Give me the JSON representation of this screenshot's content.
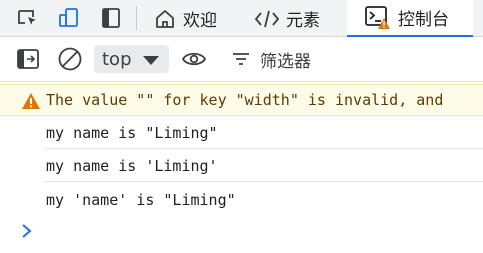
{
  "tabs": [
    {
      "label": "欢迎"
    },
    {
      "label": "元素"
    },
    {
      "label": "控制台"
    }
  ],
  "toolbar": {
    "context_value": "top",
    "filter_placeholder": "筛选器"
  },
  "console": {
    "warning": "The value \"\" for key \"width\" is invalid, and",
    "logs": [
      "my name is \"Liming\"",
      "my name is 'Liming'",
      "my 'name' is \"Liming\""
    ]
  },
  "colors": {
    "accent": "#1a73e8",
    "warning_bg": "#fefbe8",
    "warning_icon": "#e37400",
    "error_badge": "#d93025"
  }
}
